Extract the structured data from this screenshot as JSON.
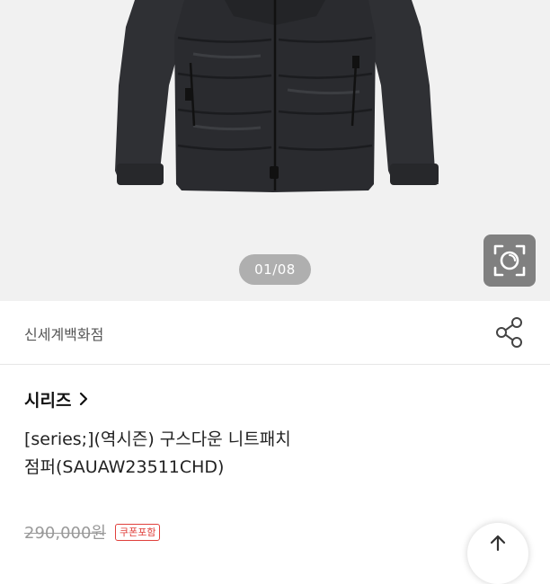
{
  "gallery": {
    "counter": "01/08",
    "image_alt": "black down jacket with knit sleeves",
    "lens_icon": "camera-lens-icon"
  },
  "store": {
    "name": "신세계백화점",
    "share_icon": "share-icon"
  },
  "product": {
    "brand": "시리즈",
    "brand_chevron_icon": "chevron-right-icon",
    "title_line1": "[series;](역시즌) 구스다운 니트패치",
    "title_line2": "점퍼(SAUAW23511CHD)",
    "original_price": "290,000원",
    "coupon_badge": "쿠폰포함"
  },
  "float_button": {
    "icon": "arrow-up-icon"
  },
  "colors": {
    "hero_bg": "#f1f1f1",
    "accent_red": "#e0403c",
    "jacket": "#2a2b2f"
  }
}
